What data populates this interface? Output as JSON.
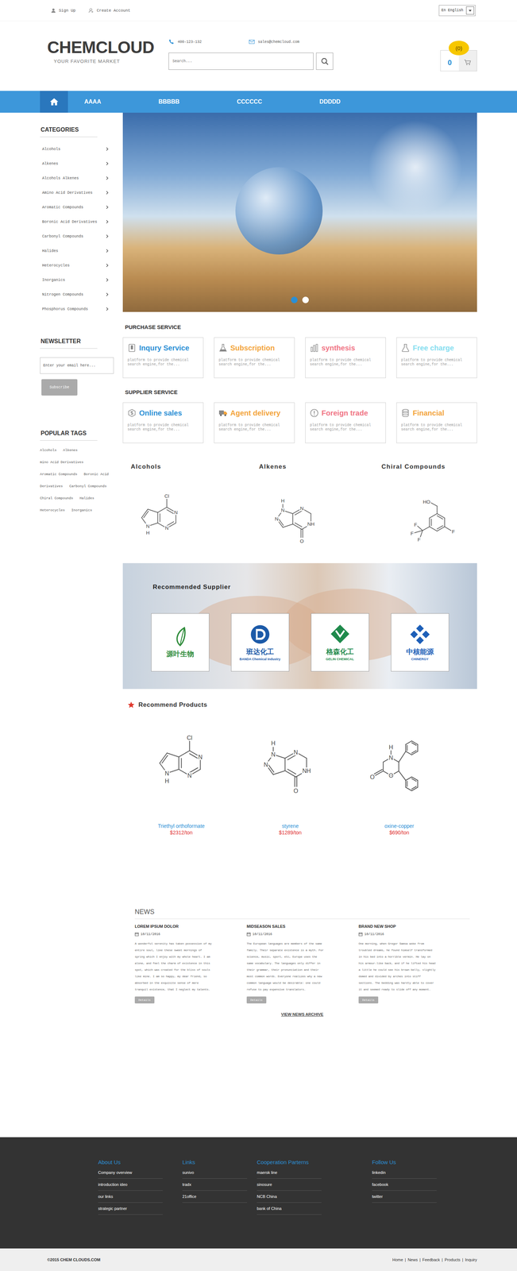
{
  "topbar": {
    "links": [
      "Sign Up",
      "Create Account"
    ],
    "language": "En English"
  },
  "header": {
    "logo": "CHEMCLOUD",
    "tagline": "YOUR FAVORITE MARKET",
    "phone": "400-123-132",
    "email": "sales@chemcloud.com",
    "search_placeholder": "Search...",
    "cart_count": "0",
    "cart_badge": "(0)"
  },
  "nav": {
    "home_selected": true,
    "items": [
      {
        "label": "AAAA",
        "selected": false
      },
      {
        "label": "BBBBB",
        "selected": false
      },
      {
        "label": "CCCCCC",
        "selected": false
      },
      {
        "label": "DDDDD",
        "selected": false
      }
    ]
  },
  "sidebar": {
    "categories_title": "CATEGORIES",
    "categories": [
      "Alcohols",
      "Alkenes",
      "Alcohols Alkenes",
      "Amino Acid Derivatives",
      "Aromatic Compounds",
      "Boronic Acid Derivatives",
      "Carbonyl Compounds",
      "Halides",
      "Heterocycles",
      "Inorganics",
      "Nitrogen Compounds",
      "Phosphorus Compounds"
    ]
  },
  "newsletter": {
    "title": "NEWSLETTER",
    "placeholder": "Enter your email here...",
    "button": "Subscribe"
  },
  "tags": {
    "title": "POPULAR TAGS",
    "items": [
      "Alcohols",
      "Alkenes",
      "mino Acid Derivatives",
      "Aromatic Compounds",
      "Boronic Acid",
      "Derivatives",
      "Carbonyl Compounds",
      "Chiral Compounds",
      "Halides",
      "Heterocycles",
      "Inorganics"
    ]
  },
  "banner": {
    "dots": [
      {
        "selected": true
      },
      {
        "selected": false
      }
    ]
  },
  "purchase_service": {
    "title": "PURCHASE SERVICE",
    "cards": [
      {
        "title": "Inqury Service",
        "text": "platform to provide chemical search engine,for the...",
        "color": "#2b8fd5"
      },
      {
        "title": "Subscription",
        "text": "platform to provide chemical search engine,for the...",
        "color": "#f3a43b"
      },
      {
        "title": "synthesis",
        "text": "platform to provide chemical search engine,for the...",
        "color": "#f07484"
      },
      {
        "title": "Free charge",
        "text": "platform to provide chemical search engine,for the...",
        "color": "#86def0"
      }
    ]
  },
  "supplier_service": {
    "title": "SUPPLIER SERVICE",
    "cards": [
      {
        "title": "Online sales",
        "text": "platform to provide chemical search engine,for the...",
        "color": "#2b8fd5"
      },
      {
        "title": "Agent delivery",
        "text": "platform to provide chemical search engine,for the...",
        "color": "#f3a43b"
      },
      {
        "title": "Foreign trade",
        "text": "platform to provide chemical search engine,for the...",
        "color": "#f07484"
      },
      {
        "title": "Financial",
        "text": "platform to provide chemical search engine,for the...",
        "color": "#f3a43b"
      }
    ]
  },
  "showcase": [
    {
      "name": "Alcohols",
      "structure": "pyrrolopyrimidine",
      "atoms": [
        "Cl",
        "N",
        "N",
        "N",
        "H"
      ]
    },
    {
      "name": "Alkenes",
      "structure": "pyrazolopyrimidinone",
      "atoms": [
        "H",
        "N",
        "N",
        "NH",
        "N",
        "O"
      ]
    },
    {
      "name": "Chiral Compounds",
      "structure": "benzylalcohol",
      "atoms": [
        "HO",
        "F",
        "F",
        "F",
        "F"
      ]
    }
  ],
  "recommended_supplier": {
    "title": "Recommended Supplier",
    "suppliers": [
      {
        "name": "源叶生物",
        "color": "#2e8b3a"
      },
      {
        "name": "班达化工",
        "subname": "BANDA Chemical Industry",
        "color": "#1c5aa8"
      },
      {
        "name": "格森化工",
        "subname": "GELIN CHEMICAL",
        "color": "#1f8a4c"
      },
      {
        "name": "中核能源",
        "subname": "CHINERGY",
        "color": "#1d5fb8"
      }
    ]
  },
  "recommend_products": {
    "title": "Recommend Products",
    "products": [
      {
        "name": "Triethyl orthoformate",
        "price": "$2312/ton",
        "structure": "pyrrolopyrimidine",
        "atoms": [
          "Cl",
          "N",
          "N",
          "N",
          "H"
        ]
      },
      {
        "name": "styrene",
        "price": "$1289/ton",
        "structure": "pyrazolopyrimidinone",
        "atoms": [
          "H",
          "N",
          "N",
          "NH",
          "N",
          "O"
        ]
      },
      {
        "name": "oxine-copper",
        "price": "$690/ton",
        "structure": "morpholinone",
        "atoms": [
          "H",
          "N",
          "O",
          "O"
        ]
      }
    ]
  },
  "news": {
    "title": "NEWS",
    "archive": "VIEW NEWS ARCHIVE",
    "items": [
      {
        "title": "LOREM IPSUM DOLOR",
        "date": "10/11/2016",
        "text": "A wonderful serenity has taken possession of my entire soul, like these sweet mornings of spring which I enjoy with my whole heart. I am alone, and feel the charm of existence in this spot, which was created for the bliss of souls like mine. I am so happy, my dear friend, so absorbed in the exquisite sense of mere tranquil existence, that I neglect my talents.",
        "button": "Details"
      },
      {
        "title": "MIDSEASON SALES",
        "date": "10/11/2016",
        "text": "The European languages are members of the same family. Their separate existence is a myth. For science, music, sport, etc, Europe uses the same vocabulary. The languages only differ in their grammar, their pronunciation and their most common words. Everyone realizes why a new common language would be desirable: one could refuse to pay expensive translators.",
        "button": "Details"
      },
      {
        "title": "BRAND NEW SHOP",
        "date": "10/11/2016",
        "text": "One morning, when Gregor Samsa woke from troubled dreams, he found himself transformed in his bed into a horrible vermin. He lay on his armour-like back, and if he lifted his head a little he could see his brown belly, slightly domed and divided by arches into stiff sections. The bedding was hardly able to cover it and seemed ready to slide off any moment.",
        "button": "Details"
      }
    ]
  },
  "footer": {
    "columns": [
      {
        "title": "About Us",
        "links": [
          "Company overview",
          "introduction ideo",
          "our links",
          "strategic partner"
        ]
      },
      {
        "title": "Links",
        "links": [
          "sunivo",
          "tradx",
          "21office"
        ]
      },
      {
        "title": "Cooperation Parterns",
        "links": [
          "maersk line",
          "sinosure",
          "NCB China",
          "bank of China"
        ]
      },
      {
        "title": "Follow Us",
        "links": [
          "linkedin",
          "facebook",
          "twitter"
        ]
      }
    ]
  },
  "bottom": {
    "copyright": "©2015 CHEM CLOUDS.COM",
    "links": [
      "Home",
      "News",
      "Feedback",
      "Products",
      "Inquiry"
    ],
    "separator": "|"
  }
}
